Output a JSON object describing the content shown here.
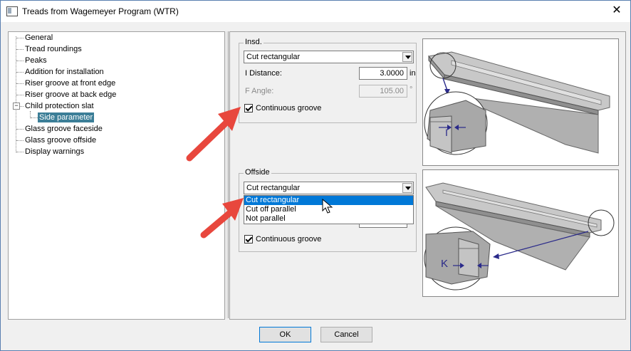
{
  "window": {
    "title": "Treads from Wagemeyer Program (WTR)",
    "close_glyph": "✕"
  },
  "tree": {
    "items": [
      {
        "label": "General"
      },
      {
        "label": "Tread roundings"
      },
      {
        "label": "Peaks"
      },
      {
        "label": "Addition for installation"
      },
      {
        "label": "Riser groove at front edge"
      },
      {
        "label": "Riser groove at back edge"
      },
      {
        "label": "Child protection slat",
        "expander": "−"
      },
      {
        "label": "Side parameter",
        "selected": true
      },
      {
        "label": "Glass groove faceside"
      },
      {
        "label": "Glass groove offside"
      },
      {
        "label": "Display warnings"
      }
    ]
  },
  "insd": {
    "group_label": "Insd.",
    "type_value": "Cut rectangular",
    "distance_label": "I Distance:",
    "distance_value": "3.0000",
    "distance_unit": "in",
    "angle_label": "F Angle:",
    "angle_value": "105.00",
    "angle_unit": "°",
    "continuous_label": "Continuous groove",
    "continuous_checked": true
  },
  "offside": {
    "group_label": "Offside",
    "type_value": "Cut rectangular",
    "options": [
      "Cut rectangular",
      "Cut off parallel",
      "Not parallel"
    ],
    "highlighted_index": 0,
    "continuous_label": "Continuous groove",
    "continuous_checked": true
  },
  "diagrams": {
    "insd_letter": "I",
    "offside_letter": "K"
  },
  "buttons": {
    "ok_label": "OK",
    "cancel_label": "Cancel"
  },
  "colors": {
    "selection": "#3b7e97",
    "highlight": "#0078d7",
    "annotation_arrow": "#e8473d",
    "diagram_arrow": "#2a2a8a",
    "tread_gray": "#a8a8a8"
  },
  "icons": [
    "app-icon",
    "close-icon",
    "dropdown-arrow-icon",
    "checkmark-icon",
    "mouse-cursor-icon",
    "red-annotation-arrow"
  ]
}
